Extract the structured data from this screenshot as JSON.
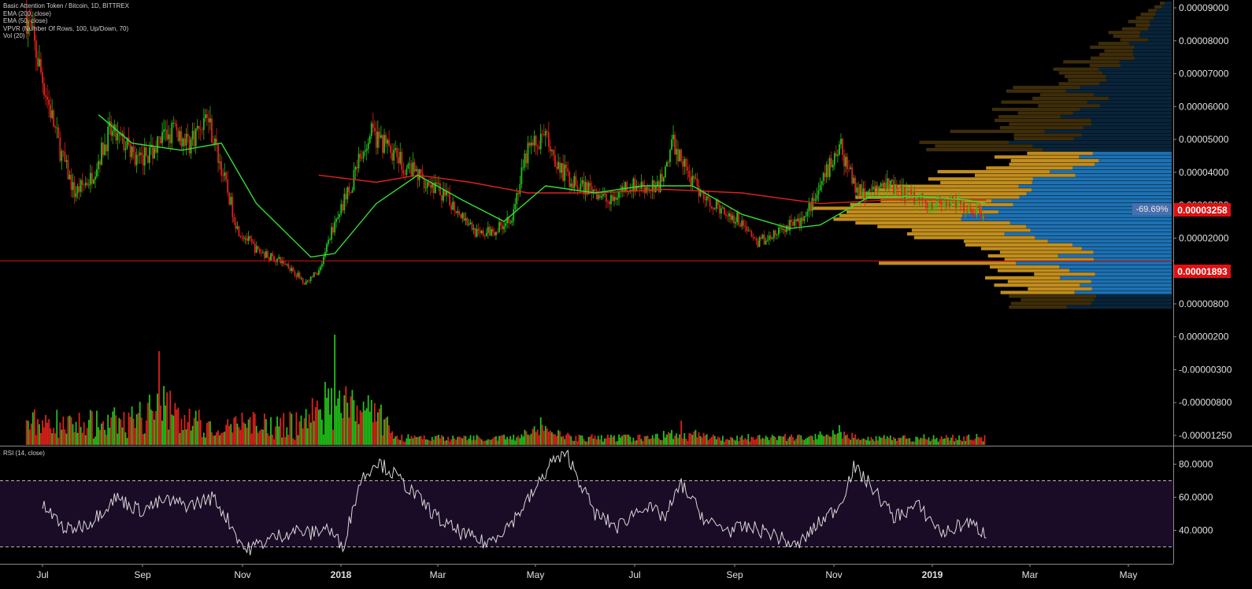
{
  "legend": {
    "title": "Basic Attention Token / Bitcoin, 1D, BITTREX",
    "ema200": "EMA (200, close)",
    "ema50": "EMA (50, close)",
    "vpvr": "VPVR (Number Of Rows, 100, Up/Down, 70)",
    "vol": "Vol (20)"
  },
  "rsi_label": "RSI (14, close)",
  "colors": {
    "background": "#000000",
    "up": "#21c21a",
    "down": "#e0211b",
    "ema200": "#e0211b",
    "ema50": "#34e034",
    "vpvr_up": "#1d71b3",
    "vpvr_down": "#c18d1d",
    "rsi_band": "#1a0b26",
    "axis_text": "#e0e0e0",
    "hline": "#e01010",
    "price_badge": "#e01010",
    "pct_badge": "#4a6fae"
  },
  "chart_data": [
    {
      "type": "candlestick",
      "title": "Basic Attention Token / Bitcoin, 1D, BITTREX",
      "x_ticks": [
        "Jul",
        "Sep",
        "Nov",
        "2018",
        "Mar",
        "May",
        "Jul",
        "Sep",
        "Nov",
        "2019",
        "Mar",
        "May"
      ],
      "y_ticks": [
        "0.00009000",
        "0.00008000",
        "0.00007000",
        "0.00006000",
        "0.00005000",
        "0.00004000",
        "0.00003000",
        "0.00002000",
        "0.00001400",
        "0.00000800",
        "0.00000200",
        "-0.00000300",
        "-0.00000800",
        "-0.00001250"
      ],
      "ylim": [
        7.5e-06,
        9.35e-05
      ],
      "series": [
        {
          "name": "BAT/BTC close",
          "x": [
            "2017-06-10",
            "2017-06-20",
            "2017-07-01",
            "2017-07-10",
            "2017-07-20",
            "2017-08-01",
            "2017-08-10",
            "2017-08-20",
            "2017-09-01",
            "2017-09-10",
            "2017-09-20",
            "2017-10-01",
            "2017-10-10",
            "2017-10-20",
            "2017-11-01",
            "2017-11-10",
            "2017-11-20",
            "2017-12-01",
            "2017-12-10",
            "2017-12-20",
            "2018-01-01",
            "2018-01-10",
            "2018-01-20",
            "2018-02-01",
            "2018-02-10",
            "2018-02-20",
            "2018-03-01",
            "2018-03-10",
            "2018-03-20",
            "2018-04-01",
            "2018-04-10",
            "2018-04-20",
            "2018-05-01",
            "2018-05-10",
            "2018-05-20",
            "2018-06-01",
            "2018-06-10",
            "2018-06-20",
            "2018-07-01",
            "2018-07-10",
            "2018-07-20",
            "2018-08-01",
            "2018-08-10",
            "2018-08-20",
            "2018-09-01",
            "2018-09-10",
            "2018-09-20",
            "2018-10-01",
            "2018-10-10",
            "2018-10-20",
            "2018-11-01",
            "2018-11-10",
            "2018-11-20",
            "2018-12-01",
            "2018-12-10",
            "2018-12-20",
            "2019-01-01",
            "2019-01-10",
            "2019-01-20",
            "2019-01-31"
          ],
          "values": [
            8.8e-05,
            7e-05,
            5e-05,
            3.8e-05,
            4.2e-05,
            5.5e-05,
            5.2e-05,
            4.7e-05,
            5.2e-05,
            5.6e-05,
            5.2e-05,
            6e-05,
            4.5e-05,
            2.8e-05,
            2.2e-05,
            2e-05,
            1.8e-05,
            1.3e-05,
            1.6e-05,
            3e-05,
            4.2e-05,
            5.5e-05,
            5.2e-05,
            4.6e-05,
            4.3e-05,
            4e-05,
            3.6e-05,
            3.2e-05,
            2.6e-05,
            2.8e-05,
            3.2e-05,
            5e-05,
            5.4e-05,
            4.5e-05,
            4e-05,
            3.9e-05,
            3.5e-05,
            4e-05,
            4e-05,
            3.9e-05,
            5.2e-05,
            4.1e-05,
            3.6e-05,
            3.3e-05,
            3e-05,
            2.4e-05,
            2.6e-05,
            2.9e-05,
            3.1e-05,
            4e-05,
            5.2e-05,
            4e-05,
            3.8e-05,
            4e-05,
            3.8e-05,
            3.6e-05,
            3.5e-05,
            3.5e-05,
            3.4e-05,
            3.258e-05
          ]
        },
        {
          "name": "EMA (50, close)",
          "x": [
            "2017-07-25",
            "2017-08-15",
            "2017-09-15",
            "2017-10-10",
            "2017-11-01",
            "2017-12-05",
            "2017-12-20",
            "2018-01-15",
            "2018-02-10",
            "2018-03-10",
            "2018-04-05",
            "2018-05-01",
            "2018-06-01",
            "2018-07-01",
            "2018-08-01",
            "2018-09-01",
            "2018-10-01",
            "2018-10-20",
            "2018-11-20",
            "2018-12-20",
            "2019-01-20",
            "2019-02-01"
          ],
          "values": [
            6e-05,
            5.2e-05,
            5e-05,
            5.2e-05,
            3.5e-05,
            2e-05,
            2.1e-05,
            3.5e-05,
            4.3e-05,
            3.6e-05,
            3e-05,
            4e-05,
            3.8e-05,
            4e-05,
            4e-05,
            3.2e-05,
            2.8e-05,
            2.9e-05,
            3.7e-05,
            3.7e-05,
            3.6e-05,
            3.5e-05
          ]
        },
        {
          "name": "EMA (200, close)",
          "x": [
            "2017-12-10",
            "2018-01-15",
            "2018-02-10",
            "2018-03-15",
            "2018-04-20",
            "2018-06-01",
            "2018-07-15",
            "2018-09-01",
            "2018-10-20",
            "2018-12-01",
            "2019-01-01",
            "2019-02-01"
          ],
          "values": [
            4.3e-05,
            4.1e-05,
            4.3e-05,
            4.1e-05,
            3.8e-05,
            3.8e-05,
            3.9e-05,
            3.8e-05,
            3.5e-05,
            3.6e-05,
            3.6e-05,
            3.6e-05
          ]
        }
      ],
      "last_price_label": "0.00003258",
      "change_label": "-69.69%",
      "support_label": "0.00001893",
      "support_value": 1.893e-05
    },
    {
      "type": "bar",
      "title": "Vol (20)",
      "note": "volume histogram, relative heights",
      "peaks": [
        {
          "x": "2017-09-01",
          "value": 0.85
        },
        {
          "x": "2017-12-20",
          "value": 1.0
        },
        {
          "x": "2018-01-10",
          "value": 0.45
        },
        {
          "x": "2018-04-28",
          "value": 0.25
        },
        {
          "x": "2018-07-25",
          "value": 0.22
        },
        {
          "x": "2018-11-01",
          "value": 0.18
        }
      ]
    },
    {
      "type": "line",
      "title": "RSI (14, close)",
      "y_ticks": [
        "80.0000",
        "60.0000",
        "40.0000"
      ],
      "ylim": [
        20,
        90
      ],
      "bands": [
        70,
        30
      ],
      "x": [
        "2017-06-20",
        "2017-07-05",
        "2017-07-20",
        "2017-08-05",
        "2017-08-20",
        "2017-09-05",
        "2017-09-20",
        "2017-10-05",
        "2017-10-15",
        "2017-10-25",
        "2017-11-10",
        "2017-11-25",
        "2017-12-05",
        "2017-12-15",
        "2017-12-25",
        "2018-01-05",
        "2018-01-15",
        "2018-01-25",
        "2018-02-10",
        "2018-02-25",
        "2018-03-10",
        "2018-03-25",
        "2018-04-10",
        "2018-04-25",
        "2018-05-05",
        "2018-05-15",
        "2018-06-01",
        "2018-06-15",
        "2018-07-01",
        "2018-07-15",
        "2018-07-25",
        "2018-08-10",
        "2018-08-25",
        "2018-09-05",
        "2018-09-20",
        "2018-10-05",
        "2018-10-20",
        "2018-11-01",
        "2018-11-10",
        "2018-11-20",
        "2018-12-05",
        "2018-12-20",
        "2019-01-05",
        "2019-01-20",
        "2019-02-01"
      ],
      "values": [
        55,
        40,
        45,
        60,
        52,
        58,
        55,
        60,
        45,
        28,
        35,
        40,
        38,
        42,
        30,
        70,
        82,
        75,
        60,
        45,
        38,
        32,
        45,
        65,
        82,
        85,
        50,
        42,
        55,
        48,
        68,
        45,
        40,
        42,
        38,
        30,
        45,
        55,
        78,
        68,
        48,
        55,
        38,
        45,
        38
      ]
    }
  ]
}
